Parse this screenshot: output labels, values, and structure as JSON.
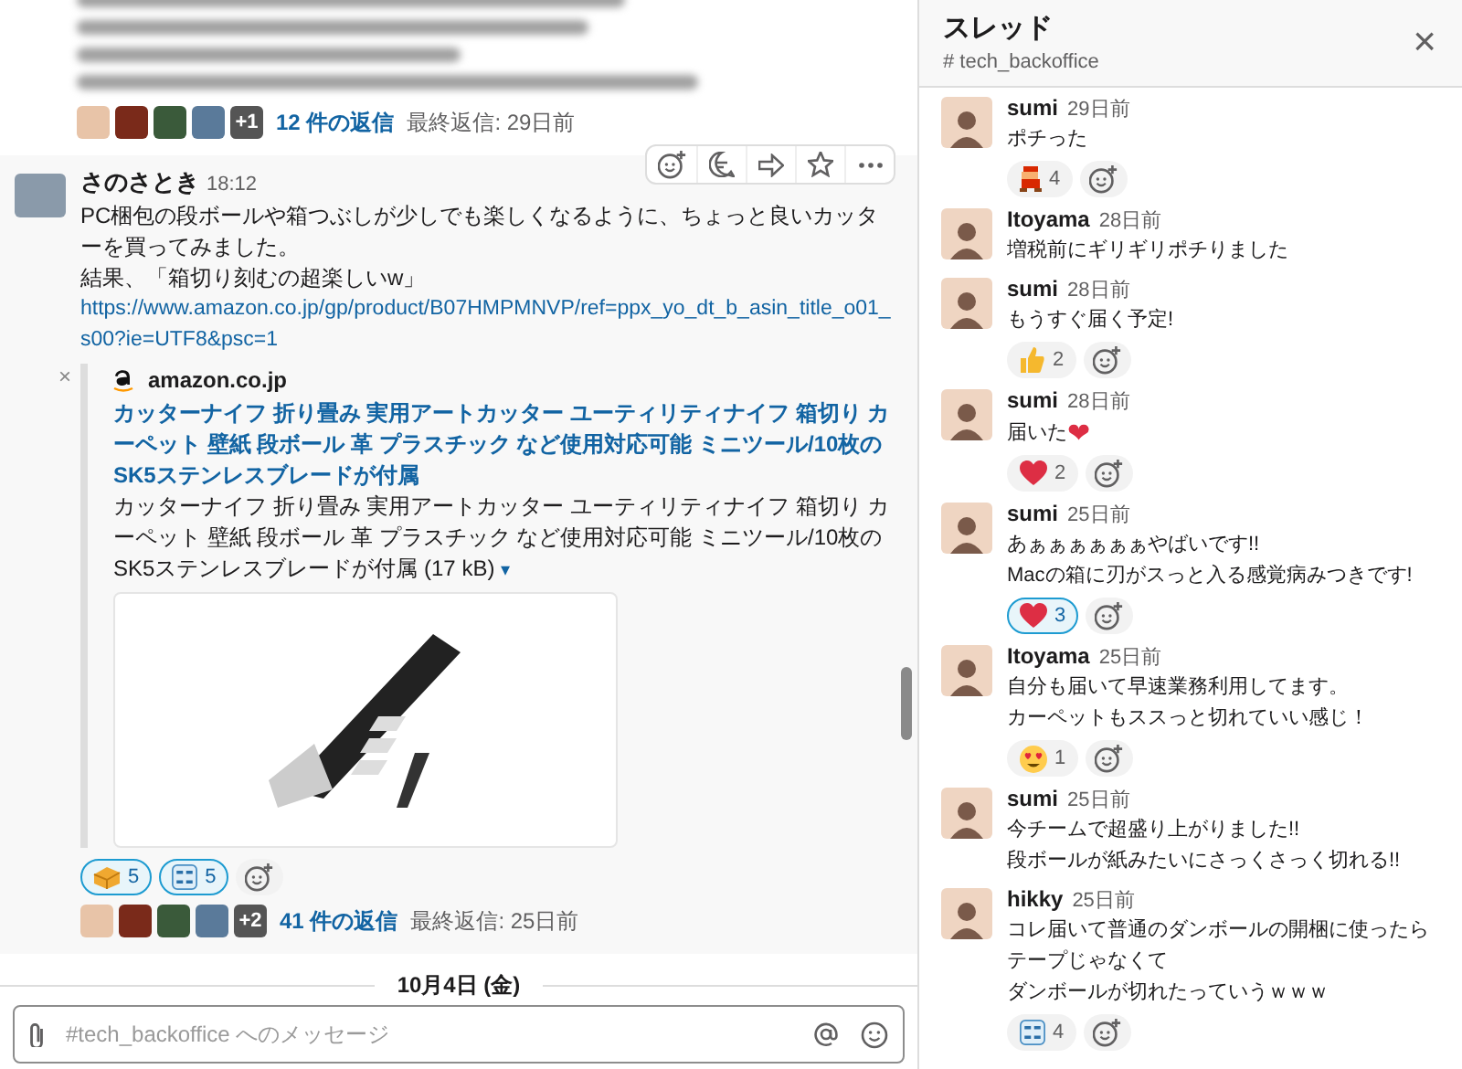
{
  "channel_pane": {
    "thread_summary_1": {
      "more": "+1",
      "replies": "12 件の返信",
      "last_reply": "最終返信: 29日前"
    },
    "message": {
      "author": "さのさとき",
      "time": "18:12",
      "body": [
        "PC梱包の段ボールや箱つぶしが少しでも楽しくなるように、ちょっと良いカッターを買ってみました。",
        "結果、「箱切り刻むの超楽しいw」"
      ],
      "link": "https://www.amazon.co.jp/gp/product/B07HMPMNVP/ref=ppx_yo_dt_b_asin_title_o01_s00?ie=UTF8&psc=1",
      "attachment": {
        "remove": "×",
        "site": "amazon.co.jp",
        "title": "カッターナイフ 折り畳み 実用アートカッター ユーティリティナイフ 箱切り カーペット 壁紙 段ボール 革 プラスチック など使用対応可能 ミニツール/10枚のSK5ステンレスブレードが付属",
        "description": "カッターナイフ 折り畳み 実用アートカッター ユーティリティナイフ 箱切り カーペット 壁紙 段ボール 革 プラスチック など使用対応可能 ミニツール/10枚のSK5ステンレスブレードが付属",
        "size": "(17 kB)",
        "toggle": "▾"
      },
      "reactions": [
        {
          "kind": "box",
          "count": "5",
          "selected": true
        },
        {
          "kind": "custom",
          "count": "5",
          "selected": true
        }
      ],
      "thread_summary": {
        "more": "+2",
        "replies": "41 件の返信",
        "last_reply": "最終返信: 25日前"
      }
    },
    "date_divider": "10月4日 (金)",
    "composer": {
      "placeholder": "#tech_backoffice へのメッセージ"
    }
  },
  "thread_pane": {
    "title": "スレッド",
    "channel": "# tech_backoffice",
    "close": "×",
    "messages": [
      {
        "author": "sumi",
        "time": "29日前",
        "lines": [
          "ポチった"
        ],
        "reactions": [
          {
            "kind": "pixel_character",
            "count": "4",
            "selected": false
          }
        ]
      },
      {
        "author": "Itoyama",
        "time": "28日前",
        "lines": [
          "増税前にギリギリポチりました"
        ]
      },
      {
        "author": "sumi",
        "time": "28日前",
        "lines": [
          "もうすぐ届く予定!"
        ],
        "reactions": [
          {
            "kind": "thumbs",
            "count": "2",
            "selected": false
          }
        ]
      },
      {
        "author": "sumi",
        "time": "28日前",
        "lines": [
          "届いた"
        ],
        "emoji": "❤",
        "reactions": [
          {
            "kind": "heart",
            "count": "2",
            "selected": false
          }
        ]
      },
      {
        "author": "sumi",
        "time": "25日前",
        "lines": [
          "あぁぁぁぁぁぁやばいです!!",
          "Macの箱に刃がスっと入る感覚病みつきです!"
        ],
        "reactions": [
          {
            "kind": "heart",
            "count": "3",
            "selected": true
          }
        ]
      },
      {
        "author": "Itoyama",
        "time": "25日前",
        "lines": [
          "自分も届いて早速業務利用してます。",
          "カーペットもススっと切れていい感じ！"
        ],
        "reactions": [
          {
            "kind": "heart_eyes",
            "count": "1",
            "selected": false
          }
        ]
      },
      {
        "author": "sumi",
        "time": "25日前",
        "lines": [
          "今チームで超盛り上がりました!!",
          "段ボールが紙みたいにさっくさっく切れる!!"
        ]
      },
      {
        "author": "hikky",
        "time": "25日前",
        "lines": [
          "コレ届いて普通のダンボールの開梱に使ったら",
          "テープじゃなくて",
          "ダンボールが切れたっていうｗｗｗ"
        ],
        "reactions": [
          {
            "kind": "custom",
            "count": "4",
            "selected": false
          }
        ]
      }
    ]
  }
}
